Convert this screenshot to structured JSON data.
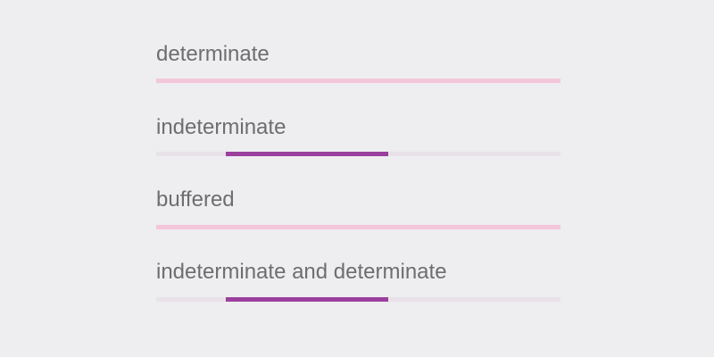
{
  "colors": {
    "background": "#eeedf0",
    "label_text": "#6e6e6e",
    "accent": "#9b3f9d",
    "track_light_pink": "#f4c6da",
    "track_light_gray": "#e8e2e8"
  },
  "progress_items": [
    {
      "label": "determinate",
      "mode": "determinate",
      "value": 0
    },
    {
      "label": "indeterminate",
      "mode": "indeterminate"
    },
    {
      "label": "buffered",
      "mode": "buffered",
      "value": 0,
      "buffer": 0
    },
    {
      "label": "indeterminate and determinate",
      "mode": "indeterminate"
    }
  ]
}
